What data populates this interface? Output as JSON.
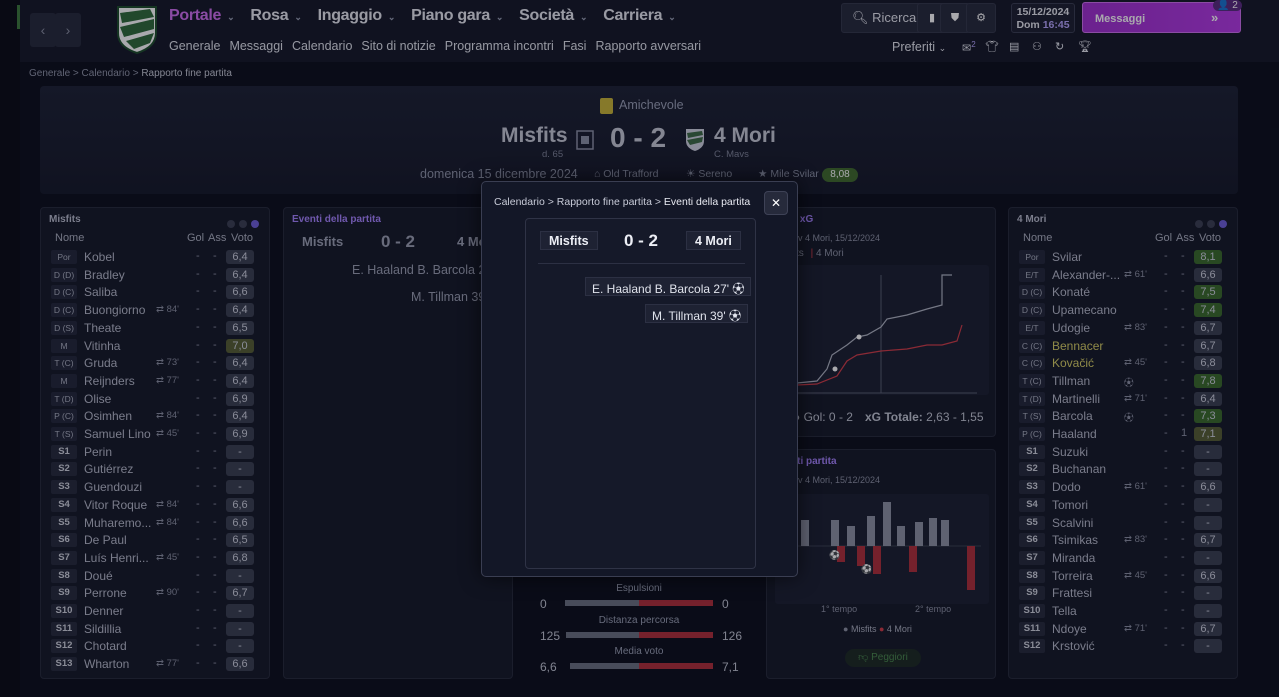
{
  "nav": {
    "menu": [
      {
        "label": "Portale",
        "active": true
      },
      {
        "label": "Rosa"
      },
      {
        "label": "Ingaggio"
      },
      {
        "label": "Piano gara"
      },
      {
        "label": "Società"
      },
      {
        "label": "Carriera"
      }
    ],
    "submenu": [
      "Generale",
      "Messaggi",
      "Calendario",
      "Sito di notizie",
      "Programma incontri",
      "Fasi",
      "Rapporto avversari"
    ],
    "search_label": "Ricerca",
    "date": "15/12/2024",
    "day": "Dom",
    "time": "16:45",
    "messages_label": "Messaggi",
    "messages_count": "2",
    "favorites_label": "Preferiti",
    "favorites_badge": "2"
  },
  "breadcrumb": [
    "Generale",
    "Calendario",
    "Rapporto fine partita"
  ],
  "match": {
    "competition": "Amichevole",
    "home": "Misfits",
    "home_sub": "d. 65",
    "away": "4 Mori",
    "away_sub": "C. Mavs",
    "score": "0 - 2",
    "date": "domenica 15 dicembre 2024",
    "stadium": "Old Trafford",
    "weather": "Sereno",
    "potm": "Mile Svilar",
    "potm_rating": "8,08"
  },
  "home_panel": {
    "title": "Misfits",
    "headers": {
      "name": "Nome",
      "goals": "Gol",
      "assists": "Ass",
      "rating": "Voto"
    },
    "players": [
      {
        "pos": "Por",
        "name": "Kobel",
        "sw": "",
        "g": "-",
        "a": "-",
        "v": "6,4"
      },
      {
        "pos": "D (D)",
        "name": "Bradley",
        "sw": "",
        "g": "-",
        "a": "-",
        "v": "6,4"
      },
      {
        "pos": "D (C)",
        "name": "Saliba",
        "sw": "",
        "g": "-",
        "a": "-",
        "v": "6,6"
      },
      {
        "pos": "D (C)",
        "name": "Buongiorno",
        "sw": "84'",
        "g": "-",
        "a": "-",
        "v": "6,4"
      },
      {
        "pos": "D (S)",
        "name": "Theate",
        "sw": "",
        "g": "-",
        "a": "-",
        "v": "6,5"
      },
      {
        "pos": "M",
        "name": "Vitinha",
        "sw": "",
        "g": "-",
        "a": "-",
        "v": "7,0",
        "vc": "lg"
      },
      {
        "pos": "T (C)",
        "name": "Gruda",
        "sw": "73'",
        "g": "-",
        "a": "-",
        "v": "6,4"
      },
      {
        "pos": "M",
        "name": "Reijnders",
        "sw": "77'",
        "g": "-",
        "a": "-",
        "v": "6,4"
      },
      {
        "pos": "T (D)",
        "name": "Olise",
        "sw": "",
        "g": "-",
        "a": "-",
        "v": "6,9"
      },
      {
        "pos": "P (C)",
        "name": "Osimhen",
        "sw": "84'",
        "g": "-",
        "a": "-",
        "v": "6,4"
      },
      {
        "pos": "T (S)",
        "name": "Samuel Lino",
        "sw": "45'",
        "g": "-",
        "a": "-",
        "v": "6,9"
      },
      {
        "pos": "S1",
        "name": "Perin",
        "sw": "",
        "g": "-",
        "a": "-",
        "v": "-",
        "sub": true
      },
      {
        "pos": "S2",
        "name": "Gutiérrez",
        "sw": "",
        "g": "-",
        "a": "-",
        "v": "-",
        "sub": true
      },
      {
        "pos": "S3",
        "name": "Guendouzi",
        "sw": "",
        "g": "-",
        "a": "-",
        "v": "-",
        "sub": true
      },
      {
        "pos": "S4",
        "name": "Vitor Roque",
        "sw": "84'",
        "g": "-",
        "a": "-",
        "v": "6,6",
        "sub": true
      },
      {
        "pos": "S5",
        "name": "Muharemo...",
        "sw": "84'",
        "g": "-",
        "a": "-",
        "v": "6,6",
        "sub": true
      },
      {
        "pos": "S6",
        "name": "De Paul",
        "sw": "",
        "g": "-",
        "a": "-",
        "v": "6,5",
        "sub": true
      },
      {
        "pos": "S7",
        "name": "Luís Henri...",
        "sw": "45'",
        "g": "-",
        "a": "-",
        "v": "6,8",
        "sub": true
      },
      {
        "pos": "S8",
        "name": "Doué",
        "sw": "",
        "g": "-",
        "a": "-",
        "v": "-",
        "sub": true
      },
      {
        "pos": "S9",
        "name": "Perrone",
        "sw": "90'",
        "g": "-",
        "a": "-",
        "v": "6,7",
        "sub": true
      },
      {
        "pos": "S10",
        "name": "Denner",
        "sw": "",
        "g": "-",
        "a": "-",
        "v": "-",
        "sub": true
      },
      {
        "pos": "S11",
        "name": "Sildillia",
        "sw": "",
        "g": "-",
        "a": "-",
        "v": "-",
        "sub": true
      },
      {
        "pos": "S12",
        "name": "Chotard",
        "sw": "",
        "g": "-",
        "a": "-",
        "v": "-",
        "sub": true
      },
      {
        "pos": "S13",
        "name": "Wharton",
        "sw": "77'",
        "g": "-",
        "a": "-",
        "v": "6,6",
        "sub": true
      }
    ]
  },
  "away_panel": {
    "title": "4 Mori",
    "headers": {
      "name": "Nome",
      "goals": "Gol",
      "assists": "Ass",
      "rating": "Voto"
    },
    "players": [
      {
        "pos": "Por",
        "name": "Svilar",
        "sw": "",
        "g": "-",
        "a": "-",
        "v": "8,1",
        "vc": "green"
      },
      {
        "pos": "E/T (D)",
        "name": "Alexander-...",
        "sw": "61'",
        "g": "-",
        "a": "-",
        "v": "6,6"
      },
      {
        "pos": "D (C)",
        "name": "Konaté",
        "sw": "",
        "g": "-",
        "a": "-",
        "v": "7,5",
        "vc": "green"
      },
      {
        "pos": "D (C)",
        "name": "Upamecano",
        "sw": "",
        "g": "-",
        "a": "-",
        "v": "7,4",
        "vc": "green"
      },
      {
        "pos": "E/T (S)",
        "name": "Udogie",
        "sw": "83'",
        "g": "-",
        "a": "-",
        "v": "6,7"
      },
      {
        "pos": "C (C)",
        "name": "Bennacer",
        "sw": "",
        "g": "-",
        "a": "-",
        "v": "6,7",
        "hl": true
      },
      {
        "pos": "C (C)",
        "name": "Kovačić",
        "sw": "45'",
        "g": "-",
        "a": "-",
        "v": "6,8",
        "hl": true
      },
      {
        "pos": "T (C)",
        "name": "Tillman",
        "sw": "goal",
        "g": "-",
        "a": "-",
        "v": "7,8",
        "vc": "green"
      },
      {
        "pos": "T (D)",
        "name": "Martinelli",
        "sw": "71'",
        "g": "-",
        "a": "-",
        "v": "6,4"
      },
      {
        "pos": "T (S)",
        "name": "Barcola",
        "sw": "goal",
        "g": "-",
        "a": "-",
        "v": "7,3",
        "vc": "green"
      },
      {
        "pos": "P (C)",
        "name": "Haaland",
        "sw": "",
        "g": "-",
        "a": "1",
        "v": "7,1",
        "vc": "lg"
      },
      {
        "pos": "S1",
        "name": "Suzuki",
        "sw": "",
        "g": "-",
        "a": "-",
        "v": "-",
        "sub": true
      },
      {
        "pos": "S2",
        "name": "Buchanan",
        "sw": "",
        "g": "-",
        "a": "-",
        "v": "-",
        "sub": true
      },
      {
        "pos": "S3",
        "name": "Dodo",
        "sw": "61'",
        "g": "-",
        "a": "-",
        "v": "6,6",
        "sub": true
      },
      {
        "pos": "S4",
        "name": "Tomori",
        "sw": "",
        "g": "-",
        "a": "-",
        "v": "-",
        "sub": true
      },
      {
        "pos": "S5",
        "name": "Scalvini",
        "sw": "",
        "g": "-",
        "a": "-",
        "v": "-",
        "sub": true
      },
      {
        "pos": "S6",
        "name": "Tsimikas",
        "sw": "83'",
        "g": "-",
        "a": "-",
        "v": "6,7",
        "sub": true
      },
      {
        "pos": "S7",
        "name": "Miranda",
        "sw": "",
        "g": "-",
        "a": "-",
        "v": "-",
        "sub": true
      },
      {
        "pos": "S8",
        "name": "Torreira",
        "sw": "45'",
        "g": "-",
        "a": "-",
        "v": "6,6",
        "sub": true
      },
      {
        "pos": "S9",
        "name": "Frattesi",
        "sw": "",
        "g": "-",
        "a": "-",
        "v": "-",
        "sub": true
      },
      {
        "pos": "S10",
        "name": "Tella",
        "sw": "",
        "g": "-",
        "a": "-",
        "v": "-",
        "sub": true
      },
      {
        "pos": "S11",
        "name": "Ndoye",
        "sw": "71'",
        "g": "-",
        "a": "-",
        "v": "6,7",
        "sub": true
      },
      {
        "pos": "S12",
        "name": "Krstović",
        "sw": "",
        "g": "-",
        "a": "-",
        "v": "-",
        "sub": true
      }
    ]
  },
  "events_panel": {
    "title": "Eventi della partita",
    "home": "Misfits",
    "away_trunc": "4 Mo",
    "score": "0 - 2",
    "event1": "E. Haaland B. Barcola 27'",
    "event2": "M. Tillman 39'"
  },
  "xg_panel": {
    "title_frag": "o xG",
    "sub": "s v 4 Mori, 15/12/2024",
    "legend_frag": "fits",
    "legend_away": "4 Mori",
    "goals": "Gol: 0 - 2",
    "xg_label": "xG Totale:",
    "xg_value": "2,63 - 1,55"
  },
  "momentum_panel": {
    "title_frag": "nti partita",
    "sub": "s v 4 Mori, 15/12/2024",
    "first_half": "1° tempo",
    "second_half": "2° tempo",
    "legend_home": "Misfits",
    "legend_away": "4 Mori",
    "worst_btn": "Peggiori"
  },
  "stats": [
    {
      "label": "Espulsioni",
      "home": "0",
      "away": "0",
      "hfrac": 1,
      "afrac": 1
    },
    {
      "label": "Distanza percorsa",
      "home": "125",
      "away": "126",
      "hfrac": 0.98,
      "afrac": 1
    },
    {
      "label": "Media voto",
      "home": "6,6",
      "away": "7,1",
      "hfrac": 0.93,
      "afrac": 1
    }
  ],
  "modal": {
    "crumb": [
      "Calendario",
      "Rapporto fine partita",
      "Eventi della partita"
    ],
    "home": "Misfits",
    "away": "4 Mori",
    "score": "0 - 2",
    "event1": "E. Haaland B. Barcola 27'",
    "event2": "M. Tillman 39'"
  }
}
